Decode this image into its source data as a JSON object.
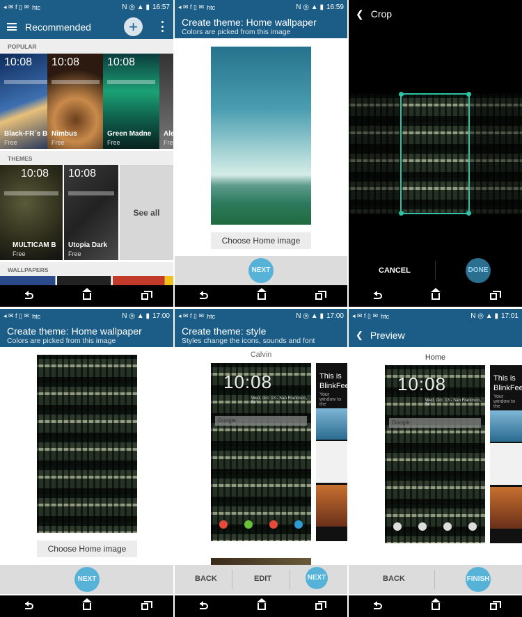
{
  "status_times": [
    "16:57",
    "16:59",
    "17:00",
    "17:00",
    "17:01"
  ],
  "carrier": "htc",
  "panel1": {
    "title": "Recommended",
    "sections": {
      "popular": "POPULAR",
      "themes": "THEMES",
      "wallpapers": "WALLPAPERS"
    },
    "popular": [
      {
        "name": "Black-FR´s B",
        "sub": "Free"
      },
      {
        "name": "Nimbus",
        "sub": "Free"
      },
      {
        "name": "Green Madne",
        "sub": "Free"
      },
      {
        "name": "Ale",
        "sub": "Free"
      }
    ],
    "themes": [
      {
        "name": "MULTICAM B",
        "sub": "Free"
      },
      {
        "name": "Utopia Dark",
        "sub": "Free"
      }
    ],
    "see_all": "See all",
    "tile_clock": "10:08"
  },
  "panel2": {
    "title": "Create theme: Home wallpaper",
    "subtitle": "Colors are picked from this image",
    "choose": "Choose Home image",
    "next": "NEXT"
  },
  "panel3": {
    "title": "Crop",
    "cancel": "CANCEL",
    "done": "DONE"
  },
  "panel4": {
    "title": "Create theme: Home wallpaper",
    "subtitle": "Colors are picked from this image",
    "choose": "Choose Home image",
    "next": "NEXT"
  },
  "panel5": {
    "title": "Create theme: style",
    "subtitle": "Styles change the icons, sounds and font",
    "style_name": "Calvin",
    "clock": "10:08",
    "date": "Wed, Oct. 13 - San Francisco, 54°",
    "search": "Google",
    "blinkfeed_title": "This is BlinkFeed",
    "blinkfeed_sub": "Your window to the",
    "back": "BACK",
    "edit": "EDIT",
    "next": "NEXT"
  },
  "panel6": {
    "title": "Preview",
    "caption": "Home",
    "clock": "10:08",
    "date": "Wed, Oct. 13 - San Francisco, 54°",
    "search": "Google",
    "blinkfeed_title": "This is BlinkFeed",
    "blinkfeed_sub": "Your window to the",
    "back": "BACK",
    "finish": "FINISH"
  },
  "colors": {
    "appbar": "#1b5d86",
    "accent": "#57b2d8",
    "crop": "#2fc3a6"
  }
}
